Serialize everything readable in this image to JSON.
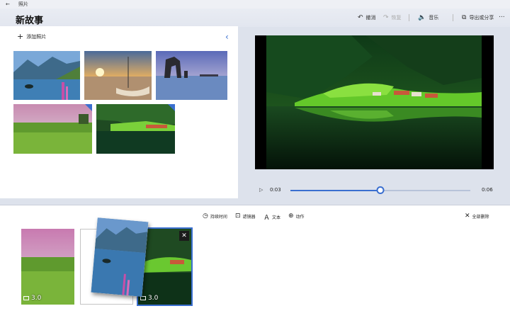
{
  "window": {
    "title": "照片",
    "back_glyph": "←"
  },
  "header": {
    "title": "新故事",
    "undo": "撤消",
    "redo": "恢复",
    "music": "音乐",
    "export": "导出或分享",
    "more": "..."
  },
  "library": {
    "add_photos": "添加照片",
    "collapse_glyph": "‹"
  },
  "player": {
    "play_glyph": "▷",
    "current": "0:03",
    "total": "0:06",
    "progress": 0.5
  },
  "toolbar": {
    "duration": "持续时间",
    "filter": "滤镜器",
    "text": "文本",
    "motion": "动作",
    "remove_all": "全部删除"
  },
  "storyboard": {
    "cards": [
      {
        "duration": "3.0"
      },
      {
        "duration": "3.0"
      }
    ],
    "close_glyph": "✕"
  },
  "colors": {
    "accent": "#3a6fd0"
  },
  "icons": {
    "undo": "undo-icon",
    "redo": "redo-icon",
    "music": "speaker-icon",
    "export": "export-icon",
    "duration": "clock-icon",
    "filter": "filter-icon",
    "text": "text-icon",
    "motion": "motion-icon",
    "remove_all": "close-icon"
  }
}
